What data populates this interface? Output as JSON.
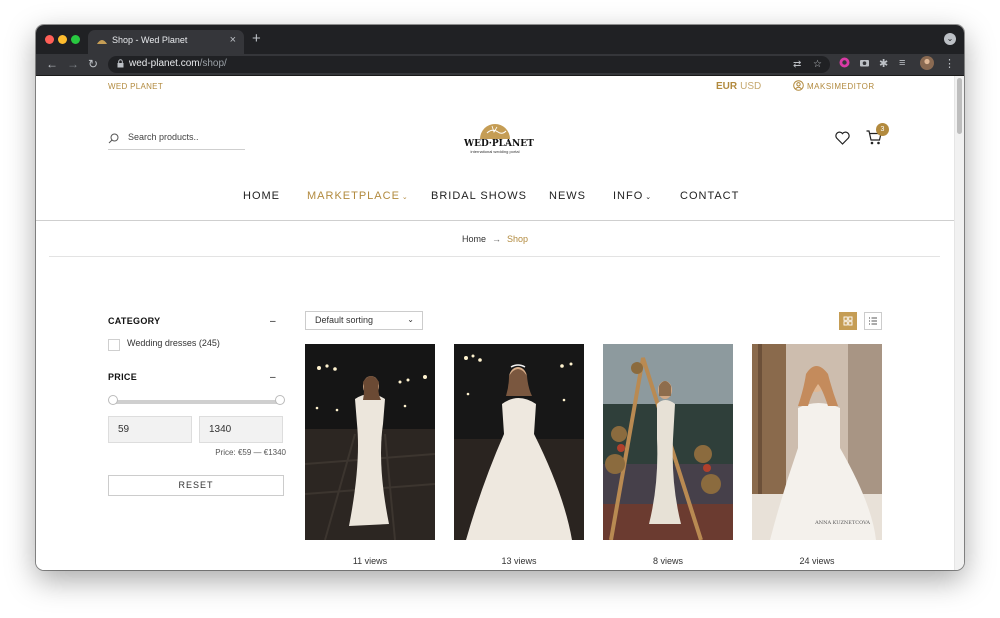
{
  "browser": {
    "tab_title": "Shop - Wed Planet",
    "new_tab": "+",
    "close_tab": "×",
    "url_host": "wed-planet.com",
    "url_path": "/shop/"
  },
  "header": {
    "brand": "WED PLANET",
    "currency_active": "EUR",
    "currency_alt": "USD",
    "account": "MAKSIMEDITOR",
    "search_placeholder": "Search products..",
    "logo_text": "WED·PLANET",
    "logo_subtitle": "international wedding portal",
    "cart_count": "3"
  },
  "nav": [
    {
      "label": "HOME"
    },
    {
      "label": "MARKETPLACE",
      "dropdown": true,
      "active": true
    },
    {
      "label": "BRIDAL SHOWS"
    },
    {
      "label": "NEWS"
    },
    {
      "label": "INFO",
      "dropdown": true
    },
    {
      "label": "CONTACT"
    }
  ],
  "breadcrumb": {
    "home": "Home",
    "separator": "→",
    "current": "Shop"
  },
  "filters": {
    "category_title": "CATEGORY",
    "category_item": "Wedding dresses",
    "category_count": "(245)",
    "price_title": "PRICE",
    "collapse": "–",
    "price_min": "59",
    "price_max": "1340",
    "price_range": "Price:  €59 — €1340",
    "reset": "RESET"
  },
  "toolbar": {
    "sorting": "Default sorting",
    "dropdown": "⌄"
  },
  "products": [
    {
      "views": "11 views",
      "scene": "night-promenade"
    },
    {
      "views": "13 views",
      "scene": "night-promenade-tiara"
    },
    {
      "views": "8 views",
      "scene": "lake-arch"
    },
    {
      "views": "24 views",
      "scene": "wooden-door",
      "watermark": "ANNA KUZNETCOVA"
    }
  ],
  "colors": {
    "accent": "#b28a3e",
    "grid_button": "#c59d55",
    "chrome_dark": "#202124",
    "chrome_toolbar": "#35363a"
  }
}
